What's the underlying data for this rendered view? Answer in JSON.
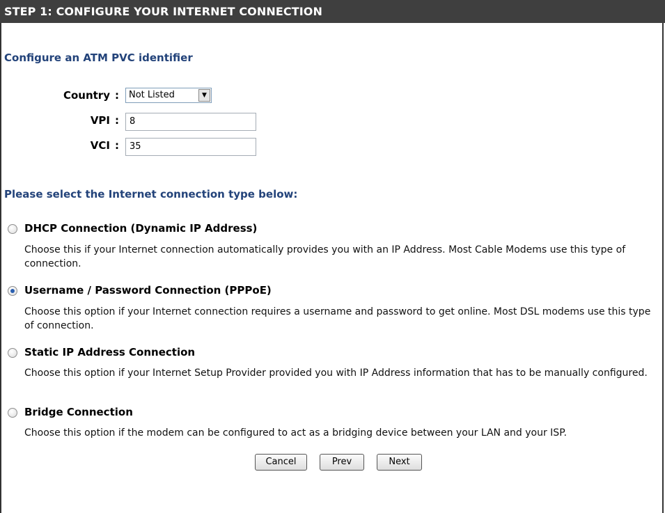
{
  "header": {
    "title": "STEP 1: CONFIGURE YOUR INTERNET CONNECTION"
  },
  "atm": {
    "heading": "Configure an ATM PVC identifier",
    "country_label": "Country",
    "country_value": "Not Listed",
    "vpi_label": "VPI",
    "vpi_value": "8",
    "vci_label": "VCI",
    "vci_value": "35",
    "colon": ":"
  },
  "connection": {
    "heading": "Please select the Internet connection type below:",
    "options": [
      {
        "title": "DHCP Connection (Dynamic IP Address)",
        "description": "Choose this if your Internet connection automatically provides you with an IP Address. Most Cable Modems use this type of connection.",
        "checked": false
      },
      {
        "title": "Username / Password Connection (PPPoE)",
        "description": "Choose this option if your Internet connection requires a username and password to get online. Most DSL modems use this type of connection.",
        "checked": true
      },
      {
        "title": "Static IP Address Connection",
        "description": "Choose this option if your Internet Setup Provider provided you with IP Address information that has to be manually configured.",
        "checked": false
      },
      {
        "title": "Bridge Connection",
        "description": "Choose this option if the modem can be configured to act as a bridging device between your LAN and your ISP.",
        "checked": false
      }
    ]
  },
  "buttons": {
    "cancel": "Cancel",
    "prev": "Prev",
    "next": "Next"
  },
  "colors": {
    "header_bg": "#3f3f3f",
    "heading_color": "#23437a",
    "radio_checked": "#2a5fb0"
  }
}
